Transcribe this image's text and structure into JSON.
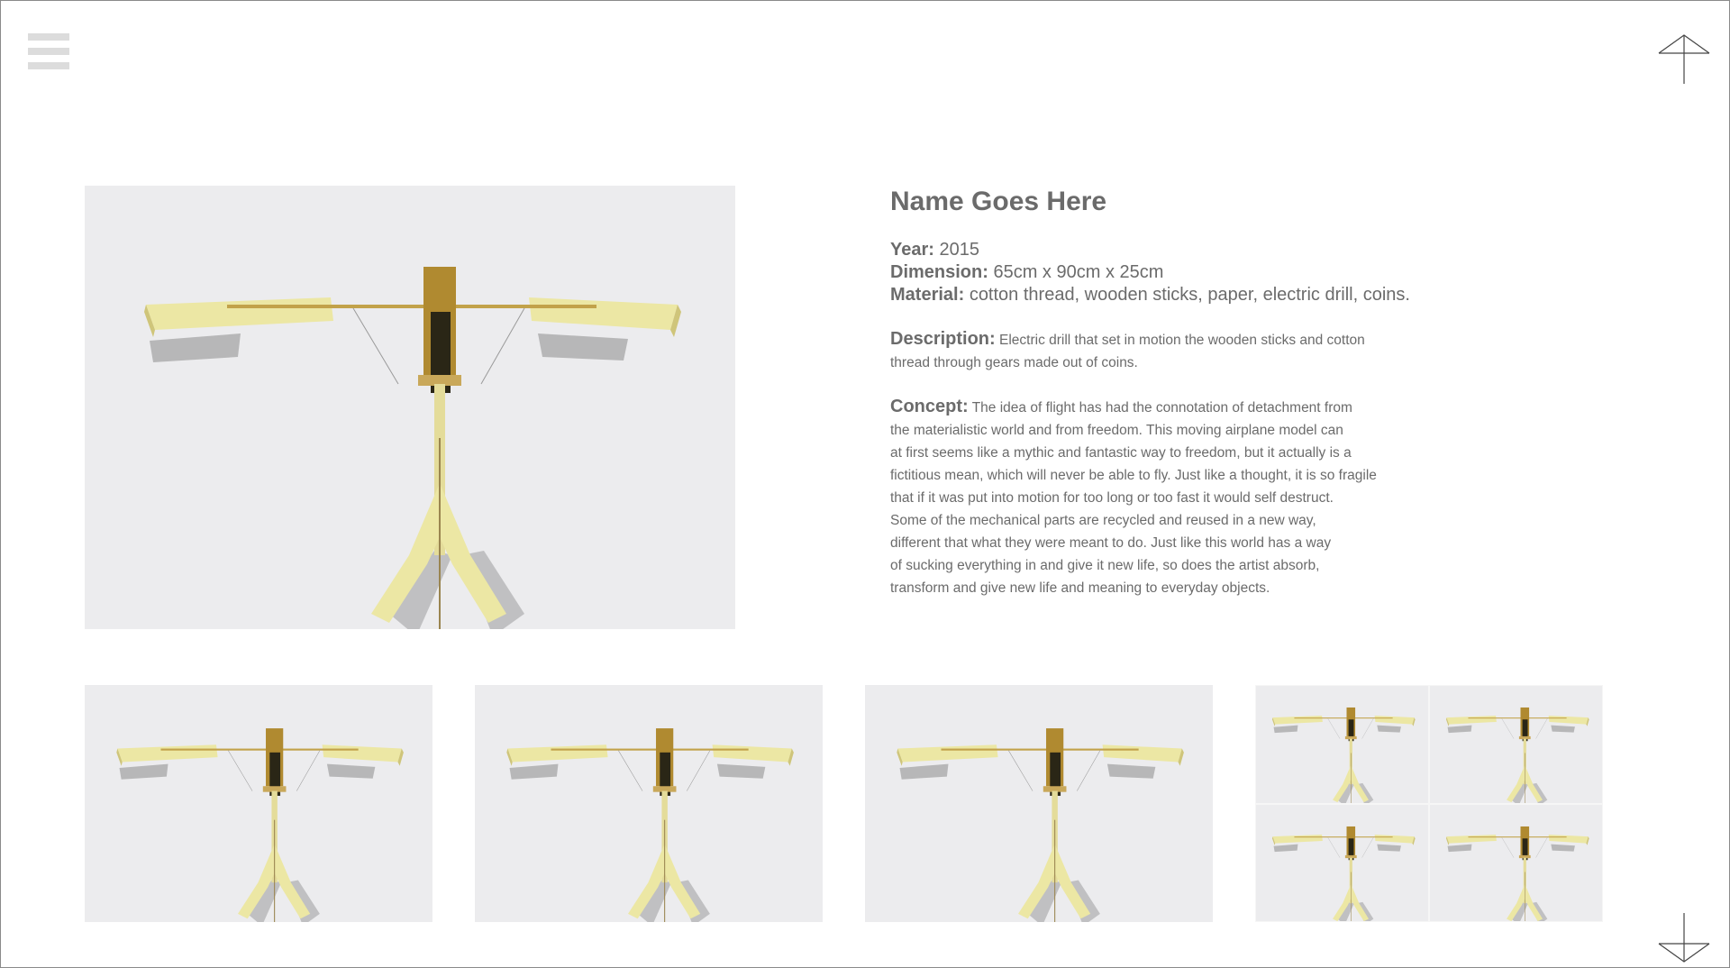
{
  "artwork": {
    "name": "Name Goes Here",
    "year_label": "Year:",
    "year": "2015",
    "dimension_label": "Dimension:",
    "dimension": "65cm x 90cm x 25cm",
    "material_label": "Material:",
    "material": "cotton thread, wooden sticks, paper, electric drill, coins.",
    "description_label": "Description:",
    "description": "Electric drill that set in motion the wooden sticks and cotton\nthread through gears made out of coins.",
    "concept_label": "Concept:",
    "concept": "The idea of flight has had the connotation of detachment from\nthe materialistic world and from freedom. This moving airplane model can\nat first seems like a mythic and fantastic way to freedom, but it actually is a\nfictitious mean, which will never be able to fly. Just like a thought, it is so fragile\nthat if it was put into motion for too long or too fast it would self destruct.\nSome of the mechanical parts are recycled and reused in a new way,\ndifferent that what they were meant to do. Just like this world has a way\nof sucking everything in and give it new life, so does the artist absorb,\ntransform and give new life and meaning to everyday objects."
  },
  "navigation": {
    "menu_icon": "hamburger-icon",
    "prev_icon": "arrow-up-icon",
    "next_icon": "arrow-down-icon"
  },
  "colors": {
    "text": "#6b6b6b",
    "photo_background": "#ececee",
    "wing": "#ece7a4",
    "fuselage": "#b08a30",
    "shadow": "#8c8c8c"
  }
}
